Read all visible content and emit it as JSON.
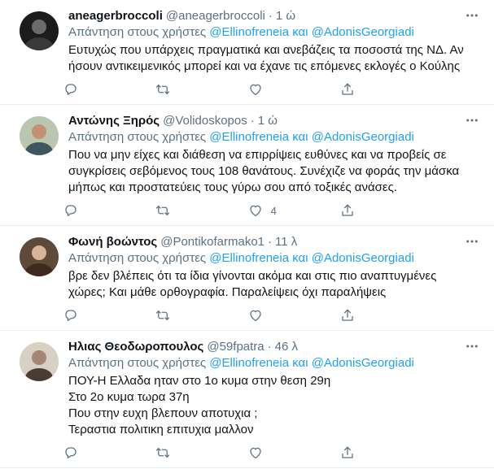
{
  "reply_prefix": "Απάντηση στους χρήστες",
  "mentions": [
    "@Ellinofreneia",
    "και",
    "@AdonisGeorgiadi"
  ],
  "colors": {
    "accent": "#1da1f2",
    "muted": "#5b7083",
    "text": "#0f1419",
    "divider": "#e6ecf0"
  },
  "icons": {
    "reply": "reply-icon",
    "retweet": "retweet-icon",
    "like": "heart-icon",
    "share": "share-icon",
    "more": "more-icon"
  },
  "tweets": [
    {
      "name": "aneagerbroccoli",
      "handle": "@aneagerbroccoli",
      "time": "1 ώ",
      "lines": [
        "Ευτυχώς που υπάρχεις πραγματικά και ανεβάζεις τα ποσοστά της ΝΔ. Αν",
        "ήσουν αντικειμενικός μπορεί και να έχανε τις επόμενες εκλογές ο Κούλης"
      ],
      "likes": ""
    },
    {
      "name": "Αντώνης Ξηρός",
      "handle": "@Volidoskopos",
      "time": "1 ώ",
      "lines": [
        "Που να μην είχες και διάθεση να επιρρίψεις ευθύνες και να προβείς σε",
        "συγκρίσεις σεβόμενος τους 108 θανάτους. Συνέχιζε να φοράς την μάσκα",
        "μήπως και προστατεύεις τους γύρω σου από τοξικές ανάσες."
      ],
      "likes": "4"
    },
    {
      "name": "Φωνή βοώντος",
      "handle": "@Pontikofarmako1",
      "time": "11 λ",
      "lines": [
        "βρε δεν βλέπεις ότι τα ίδια γίνονται ακόμα και στις πιο αναπτυγμένες",
        "χώρες; Και μάθε ορθογραφία. Παραλείψεις όχι παραλήψεις"
      ],
      "likes": ""
    },
    {
      "name": "Ηλιας Θεοδωροπουλος",
      "handle": "@59fpatra",
      "time": "46 λ",
      "lines": [
        "ΠΟΥ-Η Ελλαδα ηταν στο 1ο κυμα στην θεση 29η",
        "Στο 2ο κυμα τωρα 37η",
        "Που στην ευχη βλεπουν αποτυχια ;",
        "Τεραστια πολιτικη επιτυχια μαλλον"
      ],
      "likes": ""
    }
  ]
}
